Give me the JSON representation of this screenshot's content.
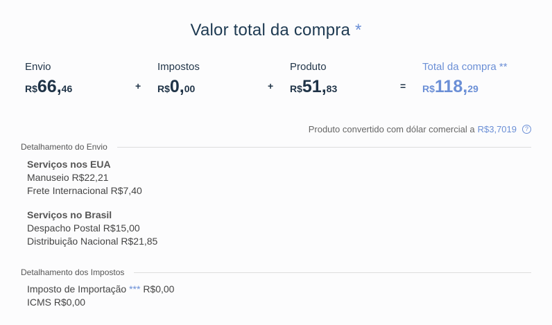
{
  "title": {
    "text": "Valor total da compra",
    "star": "*"
  },
  "totals": [
    {
      "label": "Envio",
      "currency": "R$",
      "int": "66,",
      "dec": "46"
    },
    {
      "label": "Impostos",
      "currency": "R$",
      "int": "0,",
      "dec": "00"
    },
    {
      "label": "Produto",
      "currency": "R$",
      "int": "51,",
      "dec": "83"
    },
    {
      "label": "Total da compra **",
      "currency": "R$",
      "int": "118,",
      "dec": "29"
    }
  ],
  "operators": [
    "+",
    "+",
    "="
  ],
  "rate": {
    "text": "Produto convertido com dólar comercial a",
    "value": "R$3,7019",
    "help_icon": "?"
  },
  "shipping": {
    "heading": "Detalhamento do Envio",
    "us": {
      "title": "Serviços nos EUA",
      "lines": [
        "Manuseio R$22,21",
        "Frete Internacional R$7,40"
      ]
    },
    "br": {
      "title": "Serviços no Brasil",
      "lines": [
        "Despacho Postal R$15,00",
        "Distribuição Nacional R$21,85"
      ]
    }
  },
  "taxes": {
    "heading": "Detalhamento dos Impostos",
    "import": {
      "label": "Imposto de Importação",
      "stars": "***",
      "value": "R$0,00"
    },
    "icms": "ICMS R$0,00"
  },
  "colors": {
    "accent": "#6b8fd6",
    "text": "#1f3347"
  }
}
